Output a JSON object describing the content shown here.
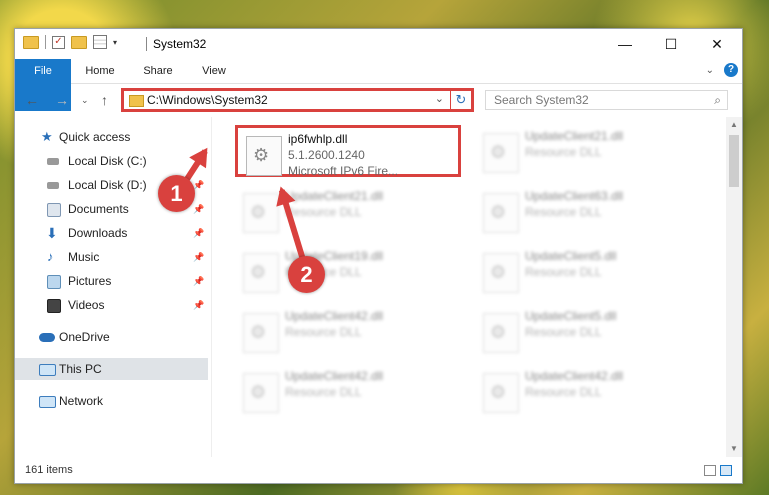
{
  "window": {
    "title": "System32"
  },
  "ribbon": {
    "tabs": [
      "File",
      "Home",
      "Share",
      "View"
    ],
    "help": "?"
  },
  "address": {
    "path": "C:\\Windows\\System32",
    "search_placeholder": "Search System32"
  },
  "sidebar": {
    "items": [
      {
        "label": "Quick access",
        "icon": "star-icon",
        "pinned": false
      },
      {
        "label": "Local Disk (C:)",
        "icon": "drive-icon",
        "pinned": true
      },
      {
        "label": "Local Disk (D:)",
        "icon": "drive-icon",
        "pinned": true
      },
      {
        "label": "Documents",
        "icon": "documents-icon",
        "pinned": true
      },
      {
        "label": "Downloads",
        "icon": "download-icon",
        "pinned": true
      },
      {
        "label": "Music",
        "icon": "music-icon",
        "pinned": true
      },
      {
        "label": "Pictures",
        "icon": "pictures-icon",
        "pinned": true
      },
      {
        "label": "Videos",
        "icon": "videos-icon",
        "pinned": true
      },
      {
        "label": "OneDrive",
        "icon": "cloud-icon",
        "pinned": false
      },
      {
        "label": "This PC",
        "icon": "computer-icon",
        "pinned": false,
        "selected": true
      },
      {
        "label": "Network",
        "icon": "network-icon",
        "pinned": false
      }
    ]
  },
  "files": [
    {
      "name": "ip6fwhlp.dll",
      "line2": "5.1.2600.1240",
      "line3": "Microsoft IPv6 Fire...",
      "highlighted": true
    },
    {
      "name": "UpdateClient21.dll",
      "line2": "Resource DLL",
      "line3": "",
      "blurred": true
    },
    {
      "name": "UpdateClient21.dll",
      "line2": "Resource DLL",
      "line3": "",
      "blurred": true
    },
    {
      "name": "UpdateClient63.dll",
      "line2": "Resource DLL",
      "line3": "",
      "blurred": true
    },
    {
      "name": "UpdateClient19.dll",
      "line2": "Resource DLL",
      "line3": "",
      "blurred": true
    },
    {
      "name": "UpdateClient5.dll",
      "line2": "Resource DLL",
      "line3": "",
      "blurred": true
    },
    {
      "name": "UpdateClient42.dll",
      "line2": "Resource DLL",
      "line3": "",
      "blurred": true
    },
    {
      "name": "UpdateClient5.dll",
      "line2": "Resource DLL",
      "line3": "",
      "blurred": true
    },
    {
      "name": "UpdateClient42.dll",
      "line2": "Resource DLL",
      "line3": "",
      "blurred": true
    },
    {
      "name": "UpdateClient42.dll",
      "line2": "Resource DLL",
      "line3": "",
      "blurred": true
    }
  ],
  "status": {
    "item_count": "161 items"
  },
  "annotations": {
    "marker1": "1",
    "marker2": "2",
    "color": "#d9413e"
  }
}
